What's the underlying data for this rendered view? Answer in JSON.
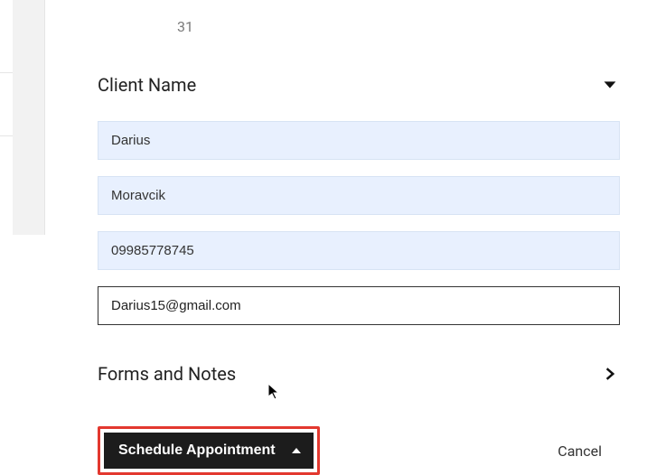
{
  "calendar": {
    "trailing_day": "31"
  },
  "sections": {
    "client": {
      "title": "Client Name"
    },
    "forms": {
      "title": "Forms and Notes"
    }
  },
  "fields": {
    "first_name": "Darius",
    "last_name": "Moravcik",
    "phone": "09985778745",
    "email": "Darius15@gmail.com"
  },
  "actions": {
    "schedule": "Schedule Appointment",
    "cancel": "Cancel"
  }
}
